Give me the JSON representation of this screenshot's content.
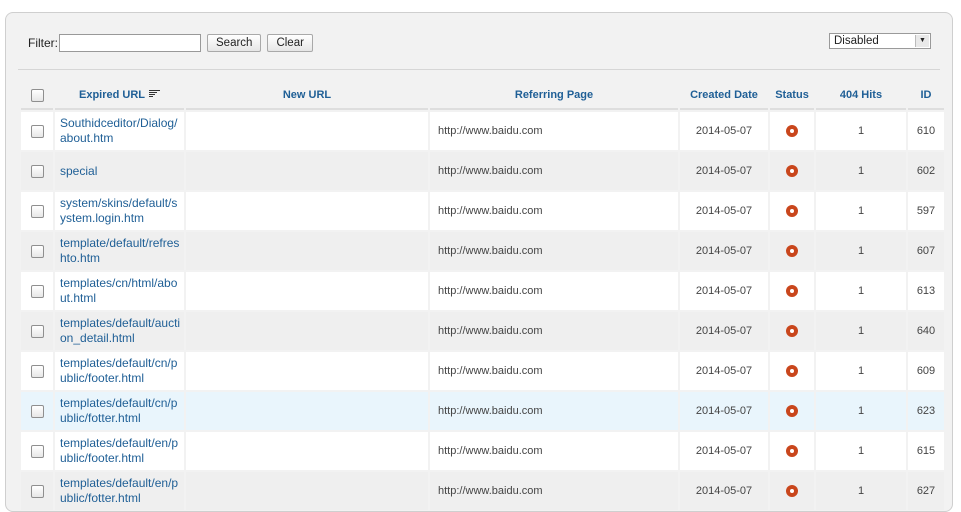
{
  "filter": {
    "label": "Filter:",
    "value": "",
    "search_label": "Search",
    "clear_label": "Clear"
  },
  "status_select": {
    "value": "Disabled"
  },
  "columns": {
    "expired_url": "Expired URL",
    "new_url": "New URL",
    "referring_page": "Referring Page",
    "created_date": "Created Date",
    "status": "Status",
    "hits": "404 Hits",
    "id": "ID"
  },
  "rows": [
    {
      "expired_url": "Southidceditor/Dialog/about.htm",
      "new_url": "",
      "referring_page": "http://www.baidu.com",
      "created_date": "2014-05-07",
      "status": "disabled",
      "hits": "1",
      "id": "610"
    },
    {
      "expired_url": "special",
      "new_url": "",
      "referring_page": "http://www.baidu.com",
      "created_date": "2014-05-07",
      "status": "disabled",
      "hits": "1",
      "id": "602"
    },
    {
      "expired_url": "system/skins/default/system.login.htm",
      "new_url": "",
      "referring_page": "http://www.baidu.com",
      "created_date": "2014-05-07",
      "status": "disabled",
      "hits": "1",
      "id": "597"
    },
    {
      "expired_url": "template/default/refreshto.htm",
      "new_url": "",
      "referring_page": "http://www.baidu.com",
      "created_date": "2014-05-07",
      "status": "disabled",
      "hits": "1",
      "id": "607"
    },
    {
      "expired_url": "templates/cn/html/about.html",
      "new_url": "",
      "referring_page": "http://www.baidu.com",
      "created_date": "2014-05-07",
      "status": "disabled",
      "hits": "1",
      "id": "613"
    },
    {
      "expired_url": "templates/default/auction_detail.html",
      "new_url": "",
      "referring_page": "http://www.baidu.com",
      "created_date": "2014-05-07",
      "status": "disabled",
      "hits": "1",
      "id": "640"
    },
    {
      "expired_url": "templates/default/cn/public/footer.html",
      "new_url": "",
      "referring_page": "http://www.baidu.com",
      "created_date": "2014-05-07",
      "status": "disabled",
      "hits": "1",
      "id": "609"
    },
    {
      "expired_url": "templates/default/cn/public/fotter.html",
      "new_url": "",
      "referring_page": "http://www.baidu.com",
      "created_date": "2014-05-07",
      "status": "disabled",
      "hits": "1",
      "id": "623"
    },
    {
      "expired_url": "templates/default/en/public/footer.html",
      "new_url": "",
      "referring_page": "http://www.baidu.com",
      "created_date": "2014-05-07",
      "status": "disabled",
      "hits": "1",
      "id": "615"
    },
    {
      "expired_url": "templates/default/en/public/fotter.html",
      "new_url": "",
      "referring_page": "http://www.baidu.com",
      "created_date": "2014-05-07",
      "status": "disabled",
      "hits": "1",
      "id": "627"
    }
  ],
  "colors": {
    "link": "#1f5f96",
    "status_disabled": "#c9461c",
    "row_alt": "#efefef",
    "row_hover": "#e9f5fc"
  },
  "icons": {
    "sort": "sort-descending-icon",
    "status": "status-disabled-icon",
    "select_arrow": "chevron-down-icon"
  }
}
